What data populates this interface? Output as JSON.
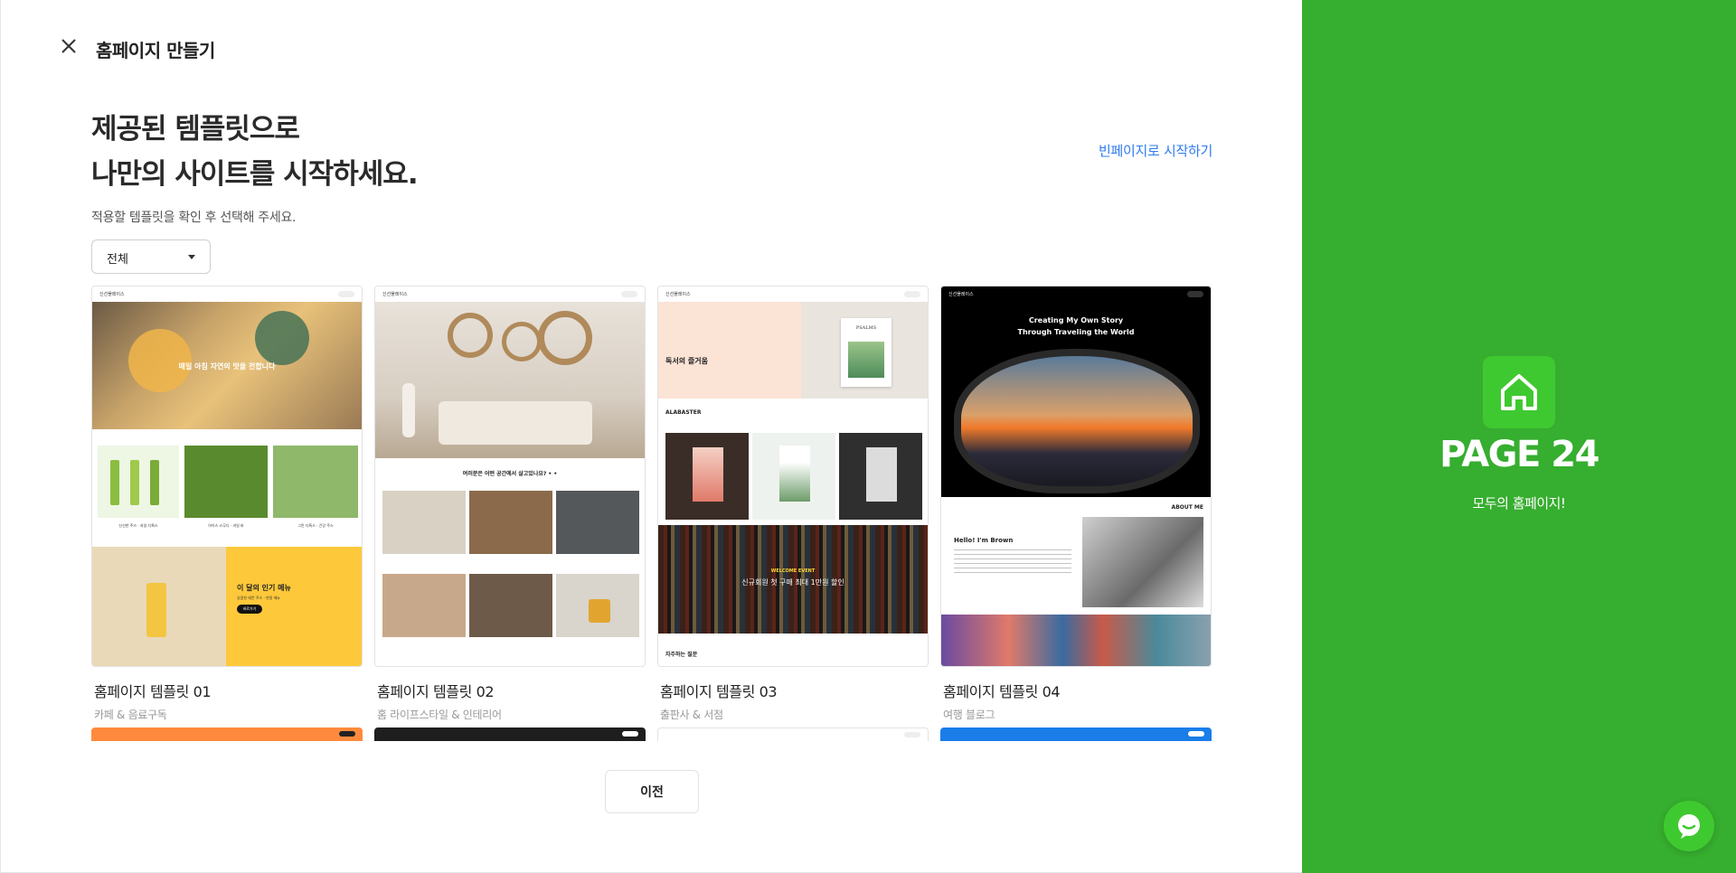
{
  "header": {
    "title": "홈페이지 만들기",
    "close_icon": "close-icon"
  },
  "intro": {
    "headline_line1": "제공된 템플릿으로",
    "headline_line2": "나만의 사이트를 시작하세요.",
    "subtext": "적용할 템플릿을 확인 후 선택해 주세요.",
    "blank_link": "빈페이지로 시작하기"
  },
  "filter": {
    "selected": "전체",
    "icon": "chevron-down-icon"
  },
  "templates": [
    {
      "title": "홈페이지 템플릿 01",
      "category": "카페 & 음료구독",
      "preview": {
        "hero_text": "매일 아침 자연의 맛을 전합니다",
        "captions": [
          "신선한 주스 · 과일 디톡스",
          "아이스 스무디 · 과일 바",
          "그린 디톡스 · 건강 주스"
        ],
        "promo_title": "이 달의 인기 메뉴",
        "promo_sub": "상큼한 레몬 주스 · 한정 메뉴",
        "promo_button": "바로가기"
      }
    },
    {
      "title": "홈페이지 템플릿 02",
      "category": "홈 라이프스타일 & 인테리어",
      "preview": {
        "section_title": "여러분은 어떤 공간에서 살고있나요? • •"
      }
    },
    {
      "title": "홈페이지 템플릿 03",
      "category": "출판사 & 서점",
      "preview": {
        "hero_title": "독서의 즐거움",
        "book_word": "PSALMS",
        "section_label": "ALABASTER",
        "banner_tag": "WELCOME EVENT",
        "banner_text": "신규회원 첫 구매 최대 1만원 할인",
        "footer_label": "자주하는 질문"
      }
    },
    {
      "title": "홈페이지 템플릿 04",
      "category": "여행 블로그",
      "preview": {
        "hero_line1": "Creating My Own Story",
        "hero_line2": "Through Traveling the World",
        "about_label": "ABOUT ME",
        "hello": "Hello! I'm Brown"
      }
    }
  ],
  "next_row_colors": [
    "#ff8a3d",
    "#1e1e1e",
    "#ffffff",
    "#1a7de8"
  ],
  "pagination": {
    "prev_label": "이전"
  },
  "sidebar": {
    "brand": "PAGE 24",
    "tagline": "모두의 홈페이지!",
    "logo_icon": "house-icon"
  },
  "chat": {
    "icon": "chat-bubble-icon"
  },
  "colors": {
    "accent_green": "#36ae2f",
    "link_blue": "#2f7cf0"
  }
}
